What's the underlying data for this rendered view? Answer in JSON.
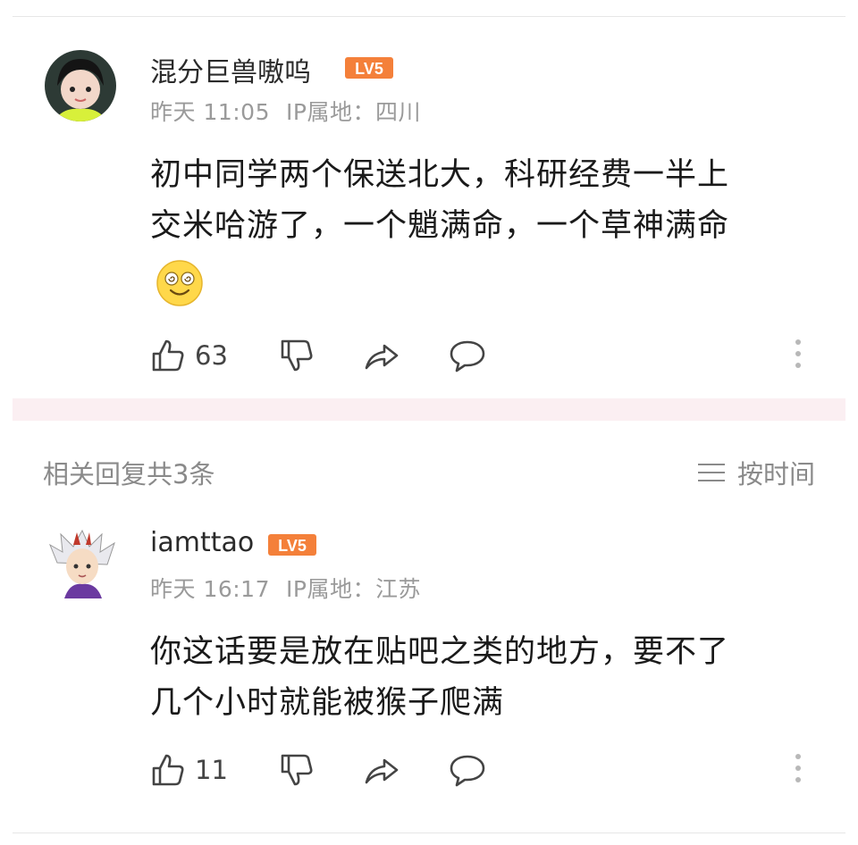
{
  "comment": {
    "username": "混分巨兽嗷呜",
    "level": "LV5",
    "time": "昨天 11:05",
    "ip": "IP属地：四川",
    "lines": [
      "初中同学两个保送北大，科研经费一半上",
      "交米哈游了，一个魈满命，一个草神满命"
    ],
    "emoji": "dizzy-smile-emoji",
    "like_count": "63"
  },
  "replies": {
    "header": "相关回复共3条",
    "sort_label": "按时间",
    "items": [
      {
        "username": "iamttao",
        "level": "LV5",
        "time": "昨天 16:17",
        "ip": "IP属地：江苏",
        "lines": [
          "你这话要是放在贴吧之类的地方，要不了",
          "几个小时就能被猴子爬满"
        ],
        "like_count": "11"
      }
    ]
  },
  "colors": {
    "level_badge": "#f4803a",
    "meta_text": "#9a9a9a",
    "divider_band": "#fbeff2"
  },
  "icons": [
    "thumbs-up-icon",
    "thumbs-down-icon",
    "share-icon",
    "comment-icon",
    "more-icon",
    "sort-icon"
  ]
}
